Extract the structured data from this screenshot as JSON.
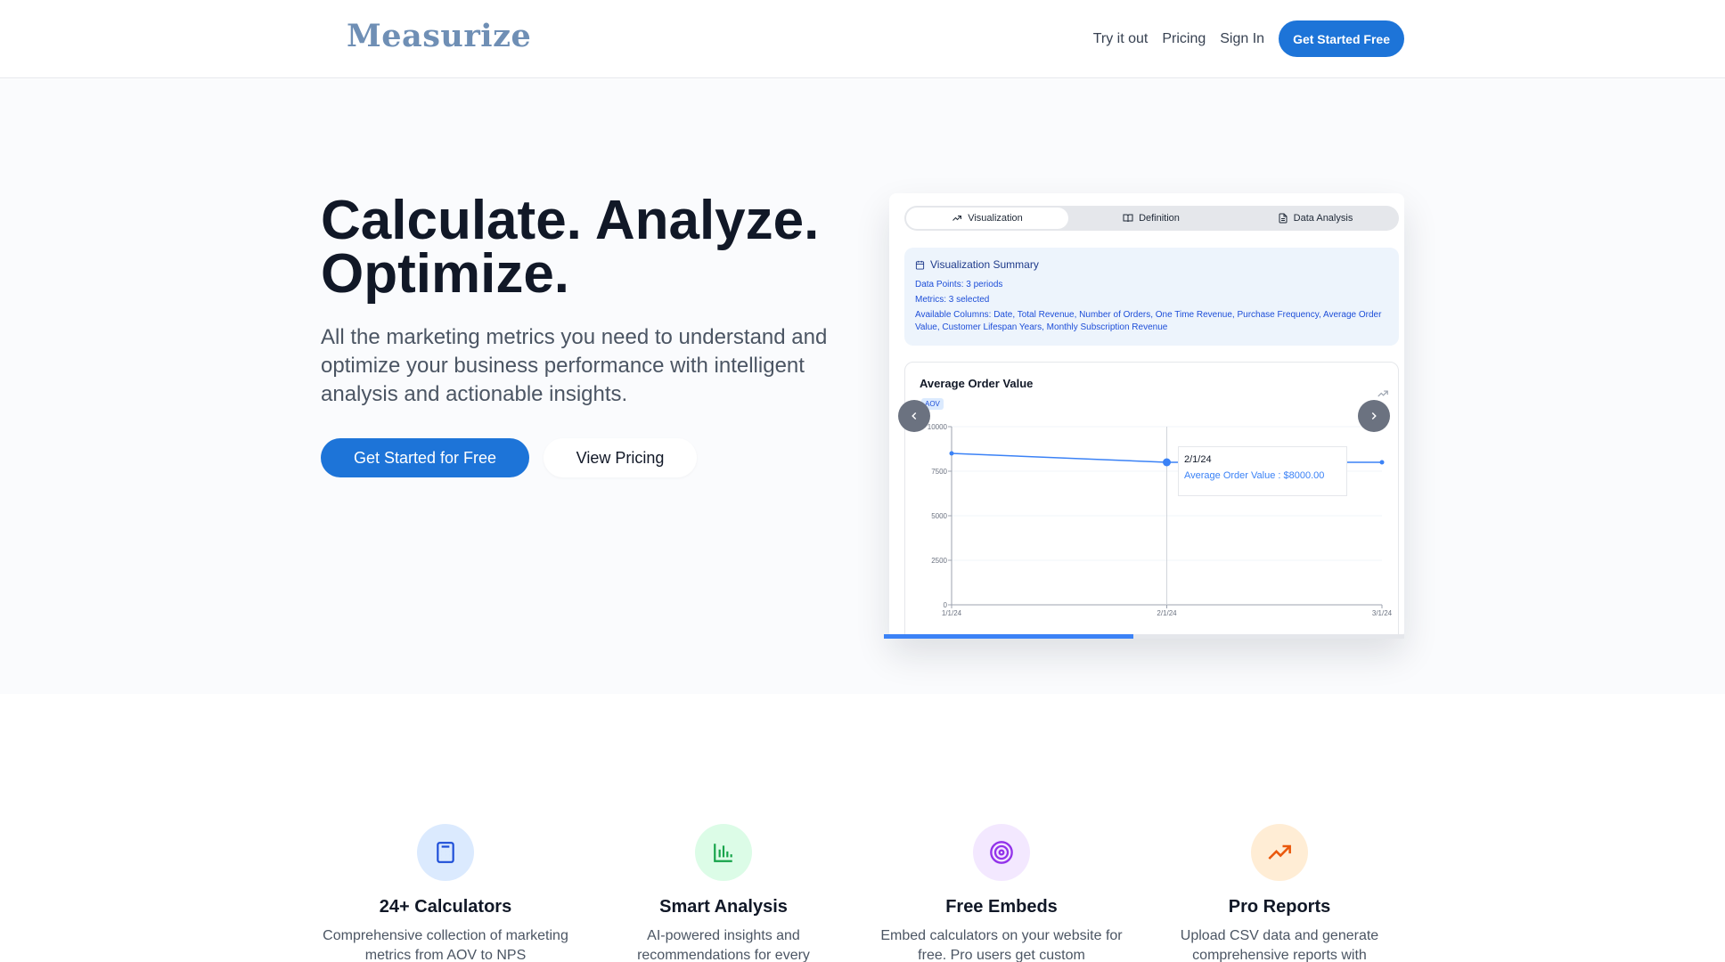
{
  "header": {
    "logo": "Measurize",
    "nav": [
      "Try it out",
      "Pricing",
      "Sign In"
    ],
    "cta": "Get Started Free"
  },
  "hero": {
    "title_line1": "Calculate. Analyze.",
    "title_line2": "Optimize.",
    "subtitle": "All the marketing metrics you need to understand and optimize your business performance with intelligent analysis and actionable insights.",
    "primary_button": "Get Started for Free",
    "secondary_button": "View Pricing"
  },
  "preview": {
    "tabs": [
      "Visualization",
      "Definition",
      "Data Analysis"
    ],
    "active_tab": 0,
    "summary": {
      "title": "Visualization Summary",
      "data_points": "Data Points: 3 periods",
      "metrics": "Metrics: 3 selected",
      "columns": "Available Columns: Date, Total Revenue, Number of Orders, One Time Revenue, Purchase Frequency, Average Order Value, Customer Lifespan Years, Monthly Subscription Revenue"
    },
    "chart_title": "Average Order Value",
    "badge": "AOV",
    "tooltip": {
      "date": "2/1/24",
      "value": "Average Order Value : $8000.00"
    },
    "progress": 0.48
  },
  "chart_data": {
    "type": "line",
    "title": "Average Order Value",
    "x": [
      "1/1/24",
      "2/1/24",
      "3/1/24"
    ],
    "series": [
      {
        "name": "Average Order Value",
        "values": [
          8500,
          8000,
          8000
        ]
      }
    ],
    "yticks": [
      "10000",
      "7500",
      "5000",
      "2500",
      "0"
    ],
    "ylim": [
      0,
      10000
    ],
    "color": "#3b82f6"
  },
  "features": [
    {
      "title": "24+ Calculators",
      "desc": "Comprehensive collection of marketing metrics from AOV to NPS",
      "icon": "calculator-icon",
      "bg": "#dbeafe",
      "fg": "#1d4ed8"
    },
    {
      "title": "Smart Analysis",
      "desc": "AI-powered insights and recommendations for every",
      "icon": "bar-chart-icon",
      "bg": "#dcfce7",
      "fg": "#16a34a"
    },
    {
      "title": "Free Embeds",
      "desc": "Embed calculators on your website for free. Pro users get custom",
      "icon": "target-icon",
      "bg": "#f3e8ff",
      "fg": "#9333ea"
    },
    {
      "title": "Pro Reports",
      "desc": "Upload CSV data and generate comprehensive reports with",
      "icon": "trending-up-icon",
      "bg": "#ffedd5",
      "fg": "#ea580c"
    }
  ]
}
